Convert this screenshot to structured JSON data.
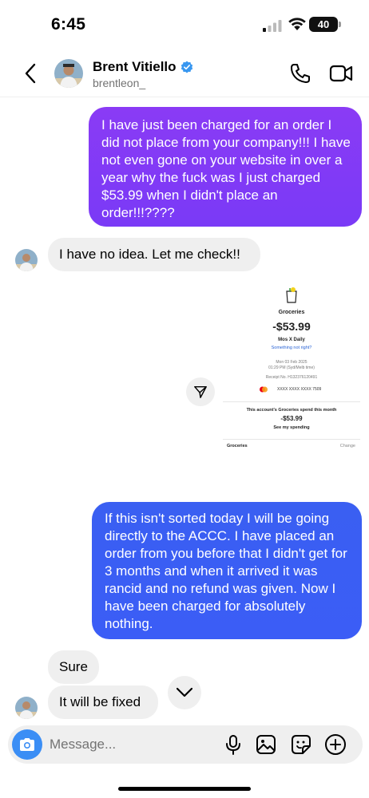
{
  "status_bar": {
    "time": "6:45",
    "battery": "40"
  },
  "header": {
    "name": "Brent Vitiello",
    "username": "brentleon_"
  },
  "messages": [
    {
      "dir": "out",
      "text": "I have just been charged for an order I did not place from your company!!! I have not even gone on your website in over a year why the fuck was I just charged $53.99 when I didn't place an order!!!????"
    },
    {
      "dir": "in",
      "text": "I have no idea. Let me check!!"
    },
    {
      "dir": "out",
      "text": "If this isn't sorted today I will be going directly to the ACCC. I have placed an order from you before that I didn't get for 3 months and when it arrived it was rancid and no refund was given. Now I have been charged for absolutely nothing."
    },
    {
      "dir": "in",
      "text": "Sure"
    },
    {
      "dir": "in",
      "text": "It will be fixed"
    }
  ],
  "receipt": {
    "category": "Groceries",
    "amount": "-$53.99",
    "merchant": "Mos X Daily",
    "help_link": "Something not right?",
    "date": "Mon 03 Feb 2025",
    "time": "01:29 PM (Syd/Melb time)",
    "receipt_no": "Receipt No. H132376120491",
    "card_number": "XXXX XXXX XXXX 7509",
    "spend_title": "This account's Groceries spend this month",
    "spend_amount": "-$53.99",
    "spend_link": "See my spending",
    "footer_label": "Groceries",
    "footer_action": "Change"
  },
  "composer": {
    "placeholder": "Message..."
  },
  "colors": {
    "outgoing_1": "#8a3bf5",
    "outgoing_2": "#3b5df6",
    "incoming": "#efefef",
    "camera": "#3b8ef5"
  }
}
